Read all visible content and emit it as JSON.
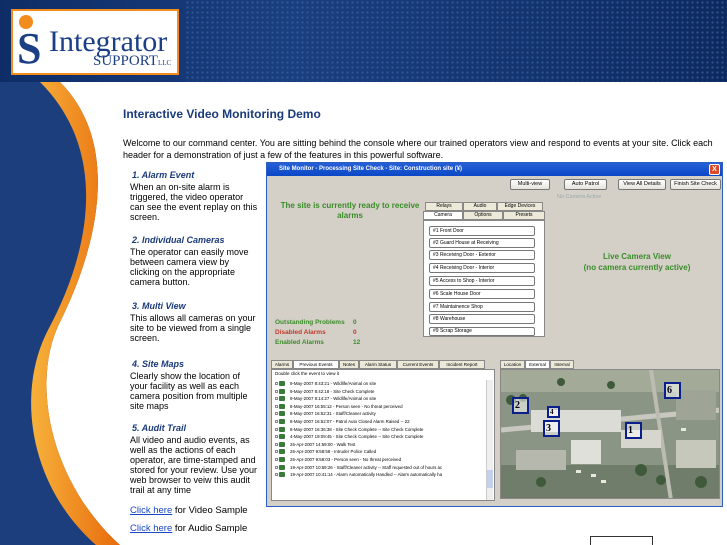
{
  "logo": {
    "letter": "S",
    "word": "Integrator",
    "sub": "SUPPORT",
    "llc": "LLC"
  },
  "page": {
    "title": "Interactive Video Monitoring Demo",
    "intro": "Welcome to our command center. You are sitting behind the console where our trained operators view and respond to events at your site. Click each header for a demonstration of just a few of the features in this powerful software."
  },
  "features": [
    {
      "heading": "1.  Alarm Event",
      "body": "When an on-site alarm is triggered, the video operator can see the event replay on this screen."
    },
    {
      "heading": "2.  Individual Cameras",
      "body": "The operator can easily move between camera view by clicking on the appropriate camera button."
    },
    {
      "heading": "3.  Multi View",
      "body": "This allows all cameras on your site to be viewed from a single screen."
    },
    {
      "heading": "4.  Site Maps",
      "body": "Clearly show the location of your facility as well as each camera position from multiple site maps"
    },
    {
      "heading": "5.  Audit Trail",
      "body": "All video and audio events, as well as the actions of each operator, are time-stamped and stored for your review. Use your web browser to veiw this audit trail at any time"
    }
  ],
  "samples": [
    {
      "link": "Click here",
      "text": " for Video Sample"
    },
    {
      "link": "Click here",
      "text": " for Audio Sample"
    }
  ],
  "app": {
    "title": "Site Monitor - Processing Site Check - Site: Construction site (¥)",
    "close": "X",
    "buttons": [
      "Multi-view",
      "Auto Patrol",
      "View All Details",
      "Finish Site Check"
    ],
    "ready": "The site is currently ready to receive alarms",
    "tabs_top": [
      "Relays",
      "Audio",
      "Edge Devices"
    ],
    "tabs_bottom": [
      "Camera",
      "Options",
      "Presets"
    ],
    "cameras": [
      "#1 Front Door",
      "#2 Guard House at Receiving",
      "#3 Receiving Door - Exterior",
      "#4 Receiving Door - Interior",
      "#5 Access to Shop - Interior",
      "#6 Scale House Door",
      "#7 Maintainence Shop",
      "#8 Warehouse",
      "#9 Scrap Storage"
    ],
    "no_camera": "No Camera Active",
    "live_title": "Live Camera View",
    "live_sub": "(no camera currently active)",
    "stats": [
      {
        "label": "Outstanding Problems",
        "value": "0",
        "color": "#3a8c28"
      },
      {
        "label": "Disabled Alarms",
        "value": "0",
        "color": "#c0392b"
      },
      {
        "label": "Enabled Alarms",
        "value": "12",
        "color": "#3a8c28"
      }
    ],
    "event_tabs": [
      "Alarms",
      "Previous Events",
      "Notes",
      "Alarm Status",
      "Current Events",
      "Incident Report"
    ],
    "event_hint": "Double click the event to view it",
    "events": [
      "9-May-2007 8:43:21 - Wildlife/Animal on site",
      "9-May-2007 8:42:18 - Site Check Complete",
      "9-May-2007 8:14:27 - Wildlife/Animal on site",
      "8-May-2007 16:55:12 - Person seen - No threat perceived",
      "8-May-2007 16:52:31 - Staff/Cleaner activity",
      "8-May-2007 16:52:07 - Patrol Auto Closed Alarm Raised -- 22",
      "8-May-2007 16:36:38 - Site Check Complete -- Site Check Complete",
      "4-May-2007 19:09:45 - Site Check Complete -- Site Check Complete",
      "26-Apr-2007 14:59:00 - Walk Test",
      "26-Apr-2007 9:58:58 - Intruder Police Called",
      "26-Apr-2007 9:58:03 - Person seen - No threat perceived",
      "19-Apr-2007 10:59:26 - Staff/Cleaner activity -- Staff requested out of hours ac",
      "19-Apr-2007 10:41:14 - Alarm Automatically Handled -- Alarm automatically ha"
    ],
    "map_tabs": [
      "Location",
      "External",
      "Internal"
    ],
    "map_markers": [
      "1",
      "2",
      "3",
      "4",
      "6"
    ]
  }
}
